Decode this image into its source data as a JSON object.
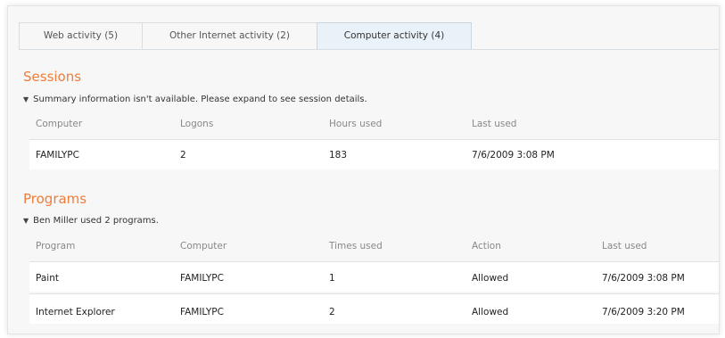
{
  "tabs": [
    {
      "label": "Web activity (5)",
      "active": false
    },
    {
      "label": "Other Internet activity (2)",
      "active": false
    },
    {
      "label": "Computer activity (4)",
      "active": true
    }
  ],
  "sessions": {
    "title": "Sessions",
    "summary": "Summary information isn't available. Please expand to see session details.",
    "columns": [
      "Computer",
      "Logons",
      "Hours used",
      "Last used"
    ],
    "rows": [
      [
        "FAMILYPC",
        "2",
        "183",
        "7/6/2009 3:08 PM"
      ]
    ]
  },
  "programs": {
    "title": "Programs",
    "summary": "Ben Miller used 2 programs.",
    "columns": [
      "Program",
      "Computer",
      "Times used",
      "Action",
      "Last used"
    ],
    "rows": [
      [
        "Paint",
        "FAMILYPC",
        "1",
        "Allowed",
        "7/6/2009 3:08 PM"
      ],
      [
        "Internet Explorer",
        "FAMILYPC",
        "2",
        "Allowed",
        "7/6/2009 3:20 PM"
      ]
    ]
  },
  "colors": {
    "accent": "#ef7d3a",
    "active_tab": "#e9f2f9"
  },
  "icons": {
    "expander": "triangle-down-icon"
  }
}
